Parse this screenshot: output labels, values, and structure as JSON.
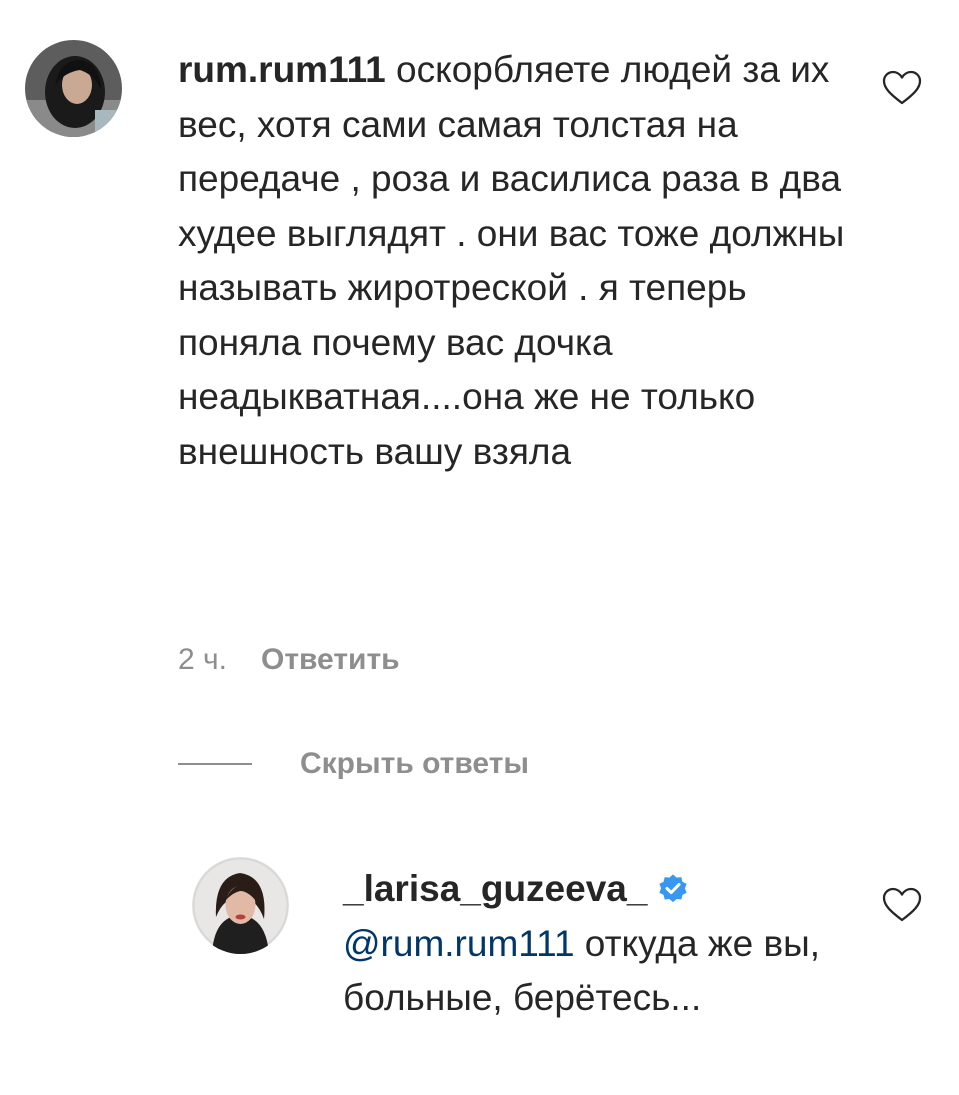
{
  "comment": {
    "username": "rum.rum111",
    "text": " оскорбляете людей за их вес, хотя сами самая толстая на передаче , роза и василиса раза в два худее выглядят . они вас тоже должны называть жиротреской . я теперь поняла почему вас дочка неадыкватная....она же не только внешность вашу взяла",
    "time": "2 ч.",
    "reply_label": "Ответить",
    "like_icon": "heart-outline-icon",
    "avatar_icon": "user-avatar-photo"
  },
  "replies_toggle": {
    "label": "Скрыть ответы"
  },
  "reply": {
    "username": "_larisa_guzeeva_",
    "verified_icon": "verified-badge-icon",
    "mention": "@rum.rum111",
    "text": " откуда же вы, больные, берётесь...",
    "like_icon": "heart-outline-icon",
    "avatar_icon": "user-avatar-photo"
  },
  "colors": {
    "text": "#262626",
    "secondary": "#8e8e8e",
    "mention": "#00376b",
    "verified": "#3897f0"
  }
}
